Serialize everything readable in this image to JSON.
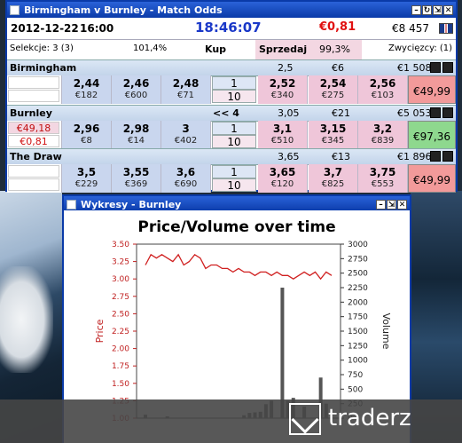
{
  "main_window": {
    "title": "Birmingham v Burnley - Match Odds",
    "date": "2012-12-22",
    "start_time": "16:00",
    "clock": "18:46:07",
    "pl": "€0,81",
    "balance": "€8 457",
    "selections": "Selekcje: 3 (3)",
    "back_pct": "101,4%",
    "back_label": "Kup",
    "lay_label": "Sprzedaj",
    "lay_pct": "99,3%",
    "winners": "Zwycięzcy: (1)",
    "flag_icon": "uk-flag-icon",
    "runners": [
      {
        "name": "Birmingham",
        "indicator": "",
        "ltp": "2,5",
        "traded": "€6",
        "matched": "€1 508",
        "left_top": "",
        "left_bottom": "",
        "back": [
          {
            "odds": "2,44",
            "vol": "€182"
          },
          {
            "odds": "2,46",
            "vol": "€600"
          },
          {
            "odds": "2,48",
            "vol": "€71"
          }
        ],
        "lay": [
          {
            "odds": "2,52",
            "vol": "€340"
          },
          {
            "odds": "2,54",
            "vol": "€275"
          },
          {
            "odds": "2,56",
            "vol": "€103"
          }
        ],
        "stake_top": "1",
        "stake_bottom": "10",
        "pnl": "€49,99",
        "pnl_color": "#f29a9a"
      },
      {
        "name": "Burnley",
        "indicator": "<< 4",
        "ltp": "3,05",
        "traded": "€21",
        "matched": "€5 053",
        "left_top": "€49,18",
        "left_bottom": "€0,81",
        "back": [
          {
            "odds": "2,96",
            "vol": "€8"
          },
          {
            "odds": "2,98",
            "vol": "€14"
          },
          {
            "odds": "3",
            "vol": "€402"
          }
        ],
        "lay": [
          {
            "odds": "3,1",
            "vol": "€510"
          },
          {
            "odds": "3,15",
            "vol": "€345"
          },
          {
            "odds": "3,2",
            "vol": "€839"
          }
        ],
        "stake_top": "1",
        "stake_bottom": "10",
        "pnl": "€97,36",
        "pnl_color": "#8ed88e"
      },
      {
        "name": "The Draw",
        "indicator": "",
        "ltp": "3,65",
        "traded": "€13",
        "matched": "€1 896",
        "left_top": "",
        "left_bottom": "",
        "back": [
          {
            "odds": "3,5",
            "vol": "€229"
          },
          {
            "odds": "3,55",
            "vol": "€369"
          },
          {
            "odds": "3,6",
            "vol": "€690"
          }
        ],
        "lay": [
          {
            "odds": "3,65",
            "vol": "€120"
          },
          {
            "odds": "3,7",
            "vol": "€825"
          },
          {
            "odds": "3,75",
            "vol": "€553"
          }
        ],
        "stake_top": "1",
        "stake_bottom": "10",
        "pnl": "€49,99",
        "pnl_color": "#f29a9a"
      }
    ]
  },
  "chart_window": {
    "title": "Wykresy - Burnley"
  },
  "chart_data": {
    "type": "line",
    "title": "Price/Volume over time",
    "ylabel_left": "Price",
    "ylabel_right": "Volume",
    "ylim_left": [
      1.0,
      3.5
    ],
    "yticks_left": [
      "3.50",
      "3.25",
      "3.00",
      "2.75",
      "2.50",
      "2.25",
      "2.00",
      "1.75",
      "1.50",
      "1.25",
      "1.00"
    ],
    "ylim_right": [
      0,
      3000
    ],
    "yticks_right": [
      "3000",
      "2750",
      "2500",
      "2250",
      "2000",
      "1750",
      "1500",
      "1250",
      "1000",
      "750",
      "500",
      "250",
      "0"
    ],
    "price_series": {
      "name": "Price",
      "color": "#d02020",
      "values": [
        3.2,
        3.35,
        3.3,
        3.35,
        3.3,
        3.25,
        3.35,
        3.2,
        3.25,
        3.35,
        3.3,
        3.15,
        3.2,
        3.2,
        3.15,
        3.15,
        3.1,
        3.15,
        3.1,
        3.1,
        3.05,
        3.1,
        3.1,
        3.05,
        3.1,
        3.05,
        3.05,
        3.0,
        3.05,
        3.1,
        3.05,
        3.1,
        3.0,
        3.1,
        3.05
      ]
    },
    "volume_series": {
      "name": "Volume",
      "color": "#555555",
      "values": [
        60,
        0,
        0,
        0,
        30,
        0,
        0,
        0,
        0,
        0,
        0,
        0,
        0,
        0,
        0,
        0,
        0,
        0,
        50,
        90,
        100,
        110,
        240,
        300,
        0,
        2250,
        300,
        350,
        0,
        200,
        0,
        0,
        700,
        250,
        0
      ]
    },
    "grid": false
  },
  "watermark": {
    "text": "traderz"
  }
}
